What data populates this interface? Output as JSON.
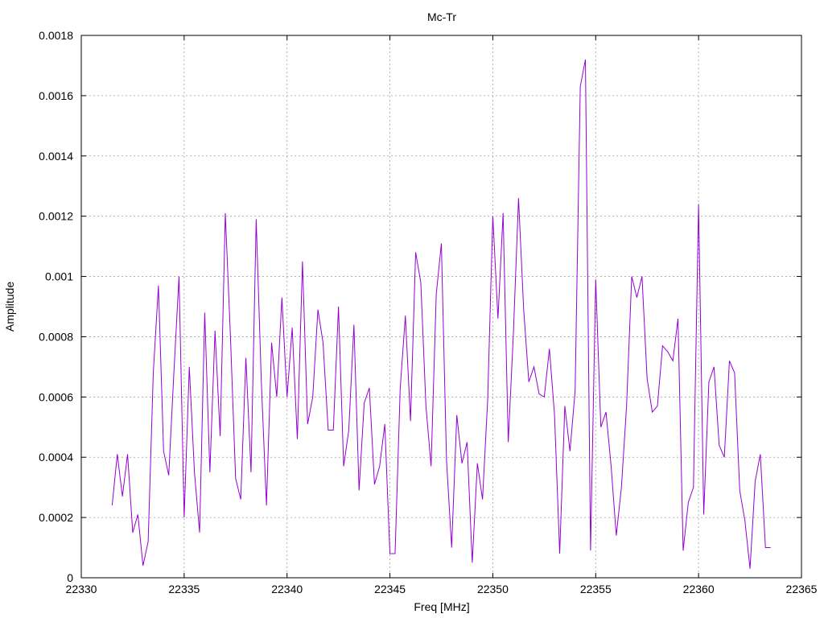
{
  "chart_data": {
    "type": "line",
    "title": "Mc-Tr",
    "xlabel": "Freq [MHz]",
    "ylabel": "Amplitude",
    "xlim": [
      22330,
      22365
    ],
    "ylim": [
      0,
      0.0018
    ],
    "xticks": [
      22330,
      22335,
      22340,
      22345,
      22350,
      22355,
      22360,
      22365
    ],
    "xtick_labels": [
      "22330",
      "22335",
      "22340",
      "22345",
      "22350",
      "22355",
      "22360",
      "22365"
    ],
    "yticks": [
      0,
      0.0002,
      0.0004,
      0.0006,
      0.0008,
      0.001,
      0.0012,
      0.0014,
      0.0016,
      0.0018
    ],
    "ytick_labels": [
      "0",
      "0.0002",
      "0.0004",
      "0.0006",
      "0.0008",
      "0.001",
      "0.0012",
      "0.0014",
      "0.0016",
      "0.0018"
    ],
    "grid": true,
    "series": [
      {
        "color": "#9400d3",
        "x": [
          22331.5,
          22331.75,
          22332.0,
          22332.25,
          22332.5,
          22332.75,
          22333.0,
          22333.25,
          22333.5,
          22333.75,
          22334.0,
          22334.25,
          22334.5,
          22334.75,
          22335.0,
          22335.25,
          22335.5,
          22335.75,
          22336.0,
          22336.25,
          22336.5,
          22336.75,
          22337.0,
          22337.25,
          22337.5,
          22337.75,
          22338.0,
          22338.25,
          22338.5,
          22338.75,
          22339.0,
          22339.25,
          22339.5,
          22339.75,
          22340.0,
          22340.25,
          22340.5,
          22340.75,
          22341.0,
          22341.25,
          22341.5,
          22341.75,
          22342.0,
          22342.25,
          22342.5,
          22342.75,
          22343.0,
          22343.25,
          22343.5,
          22343.75,
          22344.0,
          22344.25,
          22344.5,
          22344.75,
          22345.0,
          22345.25,
          22345.5,
          22345.75,
          22346.0,
          22346.25,
          22346.5,
          22346.75,
          22347.0,
          22347.25,
          22347.5,
          22347.75,
          22348.0,
          22348.25,
          22348.5,
          22348.75,
          22349.0,
          22349.25,
          22349.5,
          22349.75,
          22350.0,
          22350.25,
          22350.5,
          22350.75,
          22351.0,
          22351.25,
          22351.5,
          22351.75,
          22352.0,
          22352.25,
          22352.5,
          22352.75,
          22353.0,
          22353.25,
          22353.5,
          22353.75,
          22354.0,
          22354.25,
          22354.5,
          22354.75,
          22355.0,
          22355.25,
          22355.5,
          22355.75,
          22356.0,
          22356.25,
          22356.5,
          22356.75,
          22357.0,
          22357.25,
          22357.5,
          22357.75,
          22358.0,
          22358.25,
          22358.5,
          22358.75,
          22359.0,
          22359.25,
          22359.5,
          22359.75,
          22360.0,
          22360.25,
          22360.5,
          22360.75,
          22361.0,
          22361.25,
          22361.5,
          22361.75,
          22362.0,
          22362.25,
          22362.5,
          22362.75,
          22363.0,
          22363.25,
          22363.5
        ],
        "y": [
          0.00024,
          0.00041,
          0.00027,
          0.00041,
          0.00015,
          0.00021,
          4e-05,
          0.00012,
          0.00068,
          0.00097,
          0.00042,
          0.00034,
          0.00068,
          0.001,
          0.0002,
          0.0007,
          0.00035,
          0.00015,
          0.00088,
          0.00035,
          0.00082,
          0.00047,
          0.00121,
          0.0008,
          0.00033,
          0.00026,
          0.00073,
          0.00035,
          0.00119,
          0.00065,
          0.00024,
          0.00078,
          0.0006,
          0.00093,
          0.0006,
          0.00083,
          0.00046,
          0.00105,
          0.00051,
          0.0006,
          0.00089,
          0.00078,
          0.00049,
          0.00049,
          0.0009,
          0.00037,
          0.00049,
          0.00084,
          0.00029,
          0.00058,
          0.00063,
          0.00031,
          0.00037,
          0.00051,
          8e-05,
          8e-05,
          0.00063,
          0.00087,
          0.00052,
          0.00108,
          0.00098,
          0.00057,
          0.00037,
          0.00094,
          0.00111,
          0.00039,
          0.0001,
          0.00054,
          0.00038,
          0.00045,
          5e-05,
          0.00038,
          0.00026,
          0.00059,
          0.0012,
          0.00086,
          0.00121,
          0.00045,
          0.00081,
          0.00126,
          0.00089,
          0.00065,
          0.0007,
          0.00061,
          0.0006,
          0.00076,
          0.00054,
          8e-05,
          0.00057,
          0.00042,
          0.00062,
          0.00163,
          0.00172,
          9e-05,
          0.00099,
          0.0005,
          0.00055,
          0.00037,
          0.00014,
          0.0003,
          0.00057,
          0.001,
          0.00093,
          0.001,
          0.00066,
          0.00055,
          0.00057,
          0.00077,
          0.00075,
          0.00072,
          0.00086,
          9e-05,
          0.00025,
          0.0003,
          0.00124,
          0.00021,
          0.00065,
          0.0007,
          0.00044,
          0.0004,
          0.00072,
          0.00068,
          0.00029,
          0.00019,
          3e-05,
          0.00032,
          0.00041,
          0.0001,
          0.0001
        ]
      }
    ]
  }
}
